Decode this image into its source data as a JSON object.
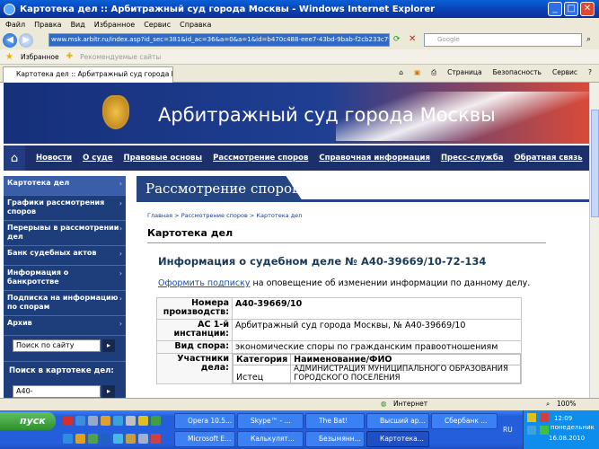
{
  "window": {
    "title": "Картотека дел :: Арбитражный суд города Москвы - Windows Internet Explorer",
    "min_label": "_",
    "max_label": "□",
    "close_label": "✕"
  },
  "menu": [
    "Файл",
    "Правка",
    "Вид",
    "Избранное",
    "Сервис",
    "Справка"
  ],
  "address": {
    "url": "www.msk.arbitr.ru/index.asp?id_sec=381&id_ac=36&a=0&a=1&id=b470c488-eee7-43bd-9bab-f2cb233c7916",
    "search_placeholder": "Google"
  },
  "favorites": {
    "label": "Избранное",
    "suggested": "Рекомендуемые сайты"
  },
  "tab": {
    "label": "Картотека дел :: Арбитражный суд города Москвы"
  },
  "commandbar": [
    "Страница",
    "Безопасность",
    "Сервис"
  ],
  "site": {
    "title": "Арбитражный суд города Москвы"
  },
  "topnav": [
    "Новости",
    "О суде",
    "Правовые основы",
    "Рассмотрение споров",
    "Справочная информация",
    "Пресс-служба",
    "Обратная связь"
  ],
  "sidebar": {
    "items": [
      "Картотека дел",
      "Графики рассмотрения споров",
      "Перерывы в рассмотрении дел",
      "Банк судебных актов",
      "Информация о банкротстве",
      "Подписка на информацию по спорам",
      "Архив"
    ],
    "site_search_placeholder": "Поиск по сайту",
    "case_search_title": "Поиск в картотеке дел:",
    "case_search_value": "А40-"
  },
  "content": {
    "section_title": "Рассмотрение споров",
    "breadcrumb": [
      "Главная",
      "Рассмотрение споров",
      "Картотека дел"
    ],
    "breadcrumb_sep": ">",
    "page_title": "Картотека дел",
    "case_header": "Информация о судебном деле № А40-39669/10-72-134",
    "subscribe_link": "Оформить подписку",
    "subscribe_text": "на оповещение об изменении информации по данному делу.",
    "info": {
      "numbers_label": "Номера производств:",
      "numbers_value": "А40-39669/10",
      "court_label": "АС 1-й инстанции:",
      "court_value": "Арбитражный суд города Москвы, № А40-39669/10",
      "dispute_label": "Вид спора:",
      "dispute_value": "экономические споры по гражданским правоотношениям",
      "parties_label": "Участники дела:",
      "parties_header_category": "Категория",
      "parties_header_name": "Наименование/ФИО",
      "party1_category": "Истец",
      "party1_name": "АДМИНИСТРАЦИЯ МУНИЦИПАЛЬНОГО ОБРАЗОВАНИЯ ГОРОДСКОГО ПОСЕЛЕНИЯ"
    }
  },
  "statusbar": {
    "zone": "Интернет",
    "zoom": "100%"
  },
  "taskbar": {
    "start": "пуск",
    "row1": [
      "Opera 10.5...",
      "Skype™ - ...",
      "The Bat!",
      "Высший ар...",
      "Сбербанк ..."
    ],
    "row2": [
      "Microsoft E...",
      "Калькулят...",
      "Безымянн...",
      "Картотека..."
    ],
    "lang": "RU",
    "time": "12:09",
    "day": "понедельник",
    "date": "16.08.2010"
  }
}
